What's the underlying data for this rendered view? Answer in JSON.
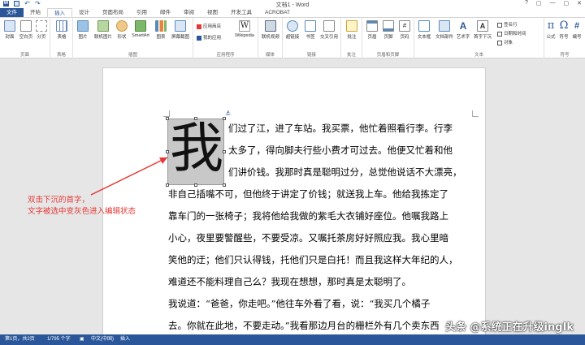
{
  "window": {
    "title": "文档1 - Word",
    "controls": [
      "?",
      "▢",
      "—",
      "▢",
      "✕"
    ]
  },
  "tabs": [
    "文件",
    "开始",
    "插入",
    "设计",
    "页面布局",
    "引用",
    "邮件",
    "审阅",
    "视图",
    "开发工具",
    "ACROBAT"
  ],
  "ribbon": {
    "groups": {
      "pages": "页面",
      "tables": "表格",
      "illustrations": "插图",
      "apps": "应用程序",
      "media": "媒体",
      "links": "链接",
      "comments": "批注",
      "header_footer": "页眉和页脚",
      "text": "文本",
      "symbols": "符号"
    },
    "buttons": {
      "cover": "封面",
      "blank": "空白页",
      "page_break": "分页",
      "table": "表格",
      "picture": "图片",
      "online_picture": "联机图片",
      "shapes": "形状",
      "smartart": "SmartArt",
      "chart": "图表",
      "screenshot": "屏幕截图",
      "store": "应用商店",
      "my_apps": "我的应用",
      "wikipedia": "Wikipedia",
      "online_video": "联机视频",
      "hyperlink": "超链接",
      "bookmark": "书签",
      "cross_ref": "交叉引用",
      "comment": "批注",
      "header": "页眉",
      "footer": "页脚",
      "page_number": "页码",
      "textbox": "文本框",
      "quick_parts": "文档部件",
      "wordart": "艺术字",
      "drop_cap": "首字下沉",
      "signature": "签名行",
      "datetime": "日期和时间",
      "object": "对象",
      "equation": "公式",
      "symbol": "符号",
      "number": "编号"
    }
  },
  "document": {
    "dropcap_char": "我",
    "lines": [
      "们过了江，进了车站。我买票，他忙着照看行李。行李",
      "太多了，得向脚夫行些小费才可过去。他便又忙着和他",
      "们讲价钱。我那时真是聪明过分，总觉他说话不大漂亮，",
      "非自己插嘴不可，但他终于讲定了价钱；就送我上车。他给我拣定了",
      "靠车门的一张椅子；我将他给我做的紫毛大衣铺好座位。他嘱我路上",
      "小心，夜里要警醒些，不要受凉。又嘱托茶房好好照应我。我心里暗",
      "笑他的迂；他们只认得钱，托他们只是白托！而且我这样大年纪的人，",
      "难道还不能料理自己么？我现在想想，那时真是太聪明了。",
      "我说道：“爸爸，你走吧。”他往车外看了看，说：“我买几个橘子",
      "去。你就在此地，不要走动。”我看那边月台的栅栏外有几个卖东西"
    ]
  },
  "annotation": {
    "line1": "双击下沉的首字，",
    "line2": "文字被选中变灰色进入编辑状态"
  },
  "statusbar": {
    "page": "第1页，共2页",
    "words": "1/795 个字",
    "proofing": "▣",
    "language": "中文(中国)",
    "mode": "插入"
  },
  "watermark": "头条 @系统正在升级ingIk",
  "colors": {
    "accent": "#2b579a",
    "annotation": "#e53935",
    "selection": "#c8c8c8"
  }
}
